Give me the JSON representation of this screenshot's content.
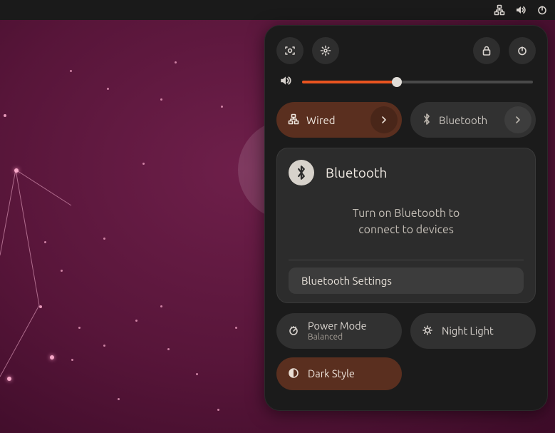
{
  "topbar": {
    "icons": [
      "network-wired-icon",
      "volume-icon",
      "power-icon"
    ]
  },
  "panel": {
    "head": {
      "screenshot_label": "screenshot",
      "settings_label": "settings",
      "lock_label": "lock",
      "power_label": "power"
    },
    "volume": {
      "percent": 41
    },
    "quick_tiles": [
      {
        "icon": "network-wired-icon",
        "label": "Wired",
        "active": true
      },
      {
        "icon": "bluetooth-icon",
        "label": "Bluetooth",
        "active": false
      }
    ],
    "bluetooth_card": {
      "title": "Bluetooth",
      "message": "Turn on Bluetooth to\nconnect to devices",
      "settings_label": "Bluetooth Settings"
    },
    "bottom_tiles": {
      "power_mode": {
        "title": "Power Mode",
        "subtitle": "Balanced"
      },
      "night_light": {
        "title": "Night Light"
      },
      "dark_style": {
        "title": "Dark Style",
        "active": true
      }
    }
  }
}
